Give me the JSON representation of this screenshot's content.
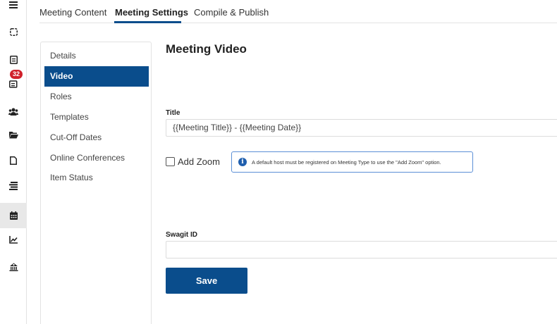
{
  "rail": {
    "notifications_count": "32"
  },
  "icons": [
    "menu-icon",
    "dashboard-icon",
    "agenda-icon",
    "inbox-icon",
    "users-icon",
    "folder-icon",
    "document-icon",
    "list-icon",
    "calendar-icon",
    "chart-icon",
    "building-icon"
  ],
  "tabs": [
    {
      "label": "Meeting Content"
    },
    {
      "label": "Meeting Settings"
    },
    {
      "label": "Compile & Publish"
    }
  ],
  "subnav": [
    {
      "label": "Details"
    },
    {
      "label": "Video"
    },
    {
      "label": "Roles"
    },
    {
      "label": "Templates"
    },
    {
      "label": "Cut-Off Dates"
    },
    {
      "label": "Online Conferences"
    },
    {
      "label": "Item Status"
    }
  ],
  "main": {
    "title": "Meeting Video",
    "title_field": {
      "label": "Title",
      "value": "{{Meeting Title}} - {{Meeting Date}}"
    },
    "add_zoom": {
      "label": "Add Zoom",
      "checked": false
    },
    "info": {
      "icon": "i",
      "text": "A default host must be registered on Meeting Type to use the \"Add Zoom\" option."
    },
    "swagit_field": {
      "label": "Swagit ID",
      "value": ""
    },
    "save_label": "Save"
  },
  "colors": {
    "primary": "#0a4d8c",
    "badge": "#d0202a",
    "info_border": "#5b8fd6"
  }
}
